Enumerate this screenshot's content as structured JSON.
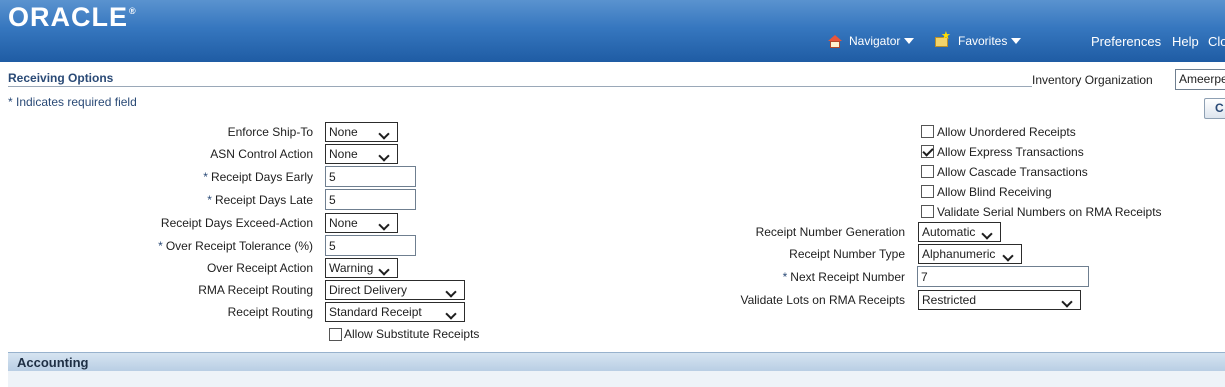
{
  "header": {
    "logo": "ORACLE",
    "logo_mark": "®",
    "navigator_label": "Navigator",
    "favorites_label": "Favorites",
    "preferences_label": "Preferences",
    "help_label": "Help",
    "close_label": "Close"
  },
  "page": {
    "title": "Receiving Options",
    "required_note": "* Indicates required field",
    "org_label": "Inventory Organization",
    "org_value": "Ameerpet",
    "corner_button": "C"
  },
  "left_form": {
    "enforce_ship_to": {
      "label": "Enforce Ship-To",
      "value": "None"
    },
    "asn_control": {
      "label": "ASN Control Action",
      "value": "None"
    },
    "days_early": {
      "label": "Receipt Days Early",
      "value": "5"
    },
    "days_late": {
      "label": "Receipt Days Late",
      "value": "5"
    },
    "exceed_action": {
      "label": "Receipt Days Exceed-Action",
      "value": "None"
    },
    "over_tolerance": {
      "label": "Over Receipt Tolerance (%)",
      "value": "5"
    },
    "over_action": {
      "label": "Over Receipt Action",
      "value": "Warning"
    },
    "rma_routing": {
      "label": "RMA Receipt Routing",
      "value": "Direct Delivery"
    },
    "receipt_routing": {
      "label": "Receipt Routing",
      "value": "Standard Receipt"
    },
    "substitute": {
      "label": "Allow Substitute Receipts",
      "checked": false
    },
    "required_marker": "*"
  },
  "right_form": {
    "unordered": {
      "label": "Allow Unordered Receipts",
      "checked": false
    },
    "express": {
      "label": "Allow Express Transactions",
      "checked": true
    },
    "cascade": {
      "label": "Allow Cascade Transactions",
      "checked": false
    },
    "blind": {
      "label": "Allow Blind Receiving",
      "checked": false
    },
    "validate_serial": {
      "label": "Validate Serial Numbers on RMA Receipts",
      "checked": false
    },
    "number_generation": {
      "label": "Receipt Number Generation",
      "value": "Automatic"
    },
    "number_type": {
      "label": "Receipt Number Type",
      "value": "Alphanumeric"
    },
    "next_number": {
      "label": "Next Receipt Number",
      "value": "7"
    },
    "validate_lots": {
      "label": "Validate Lots on RMA Receipts",
      "value": "Restricted"
    }
  },
  "accounting": {
    "title": "Accounting"
  }
}
